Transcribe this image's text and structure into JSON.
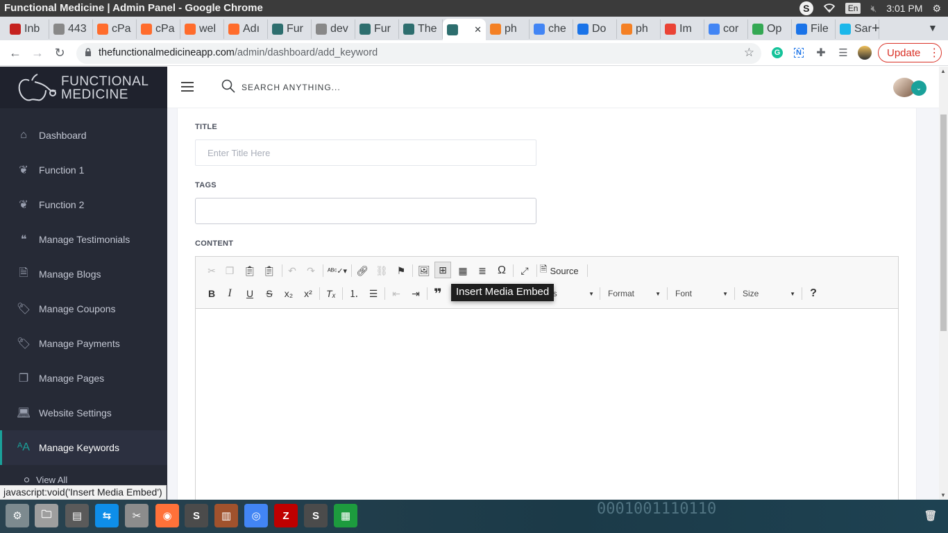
{
  "os": {
    "window_title": "Functional Medicine | Admin Panel - Google Chrome",
    "tray_s": "S",
    "lang": "En",
    "time": "3:01 PM"
  },
  "tabs": [
    {
      "label": "Inb",
      "color": "#c5221f"
    },
    {
      "label": "443",
      "color": "#888888"
    },
    {
      "label": "cPa",
      "color": "#ff6c2c"
    },
    {
      "label": "cPa",
      "color": "#ff6c2c"
    },
    {
      "label": "wel",
      "color": "#ff6c2c"
    },
    {
      "label": "Adı",
      "color": "#ff6c2c"
    },
    {
      "label": "Fur",
      "color": "#2d6e6e"
    },
    {
      "label": "dev",
      "color": "#888888"
    },
    {
      "label": "Fur",
      "color": "#2d6e6e"
    },
    {
      "label": "The",
      "color": "#2d6e6e"
    },
    {
      "label": "",
      "color": "#2d6e6e",
      "active": true
    },
    {
      "label": "ph",
      "color": "#f48024"
    },
    {
      "label": "che",
      "color": "#4285f4"
    },
    {
      "label": "Do",
      "color": "#1a73e8"
    },
    {
      "label": "ph",
      "color": "#f48024"
    },
    {
      "label": "Im",
      "color": "#ea4335"
    },
    {
      "label": "cor",
      "color": "#4285f4"
    },
    {
      "label": "Op",
      "color": "#34a853"
    },
    {
      "label": "File",
      "color": "#1a73e8"
    },
    {
      "label": "Sar",
      "color": "#1ab7ea"
    }
  ],
  "omnibox": {
    "host": "thefunctionalmedicineapp.com",
    "path": "/admin/dashboard/add_keyword"
  },
  "update_label": "Update",
  "brand": {
    "line1": "FUNCTIONAL",
    "line2": "MEDICINE"
  },
  "sidebar": {
    "items": [
      {
        "label": "Dashboard",
        "icon": "home-icon"
      },
      {
        "label": "Function 1",
        "icon": "leaf-icon"
      },
      {
        "label": "Function 2",
        "icon": "leaf-icon"
      },
      {
        "label": "Manage Testimonials",
        "icon": "quote-icon"
      },
      {
        "label": "Manage Blogs",
        "icon": "document-icon"
      },
      {
        "label": "Manage Coupons",
        "icon": "tags-icon"
      },
      {
        "label": "Manage Payments",
        "icon": "tags-icon"
      },
      {
        "label": "Manage Pages",
        "icon": "pages-icon"
      },
      {
        "label": "Website Settings",
        "icon": "laptop-icon"
      },
      {
        "label": "Manage Keywords",
        "icon": "font-size-icon",
        "active": true
      }
    ],
    "sub_view_all": "View All"
  },
  "header": {
    "search_placeholder": "SEARCH ANYTHING..."
  },
  "form": {
    "title_label": "TITLE",
    "title_placeholder": "Enter Title Here",
    "tags_label": "TAGS",
    "tags_value": "",
    "content_label": "CONTENT"
  },
  "editor": {
    "source_label": "Source",
    "styles_label": "es",
    "format_label": "Format",
    "font_label": "Font",
    "size_label": "Size",
    "tooltip": "Insert Media Embed"
  },
  "status_url": "javascript:void('Insert Media Embed')",
  "taskbar_binary": "0001001110110"
}
